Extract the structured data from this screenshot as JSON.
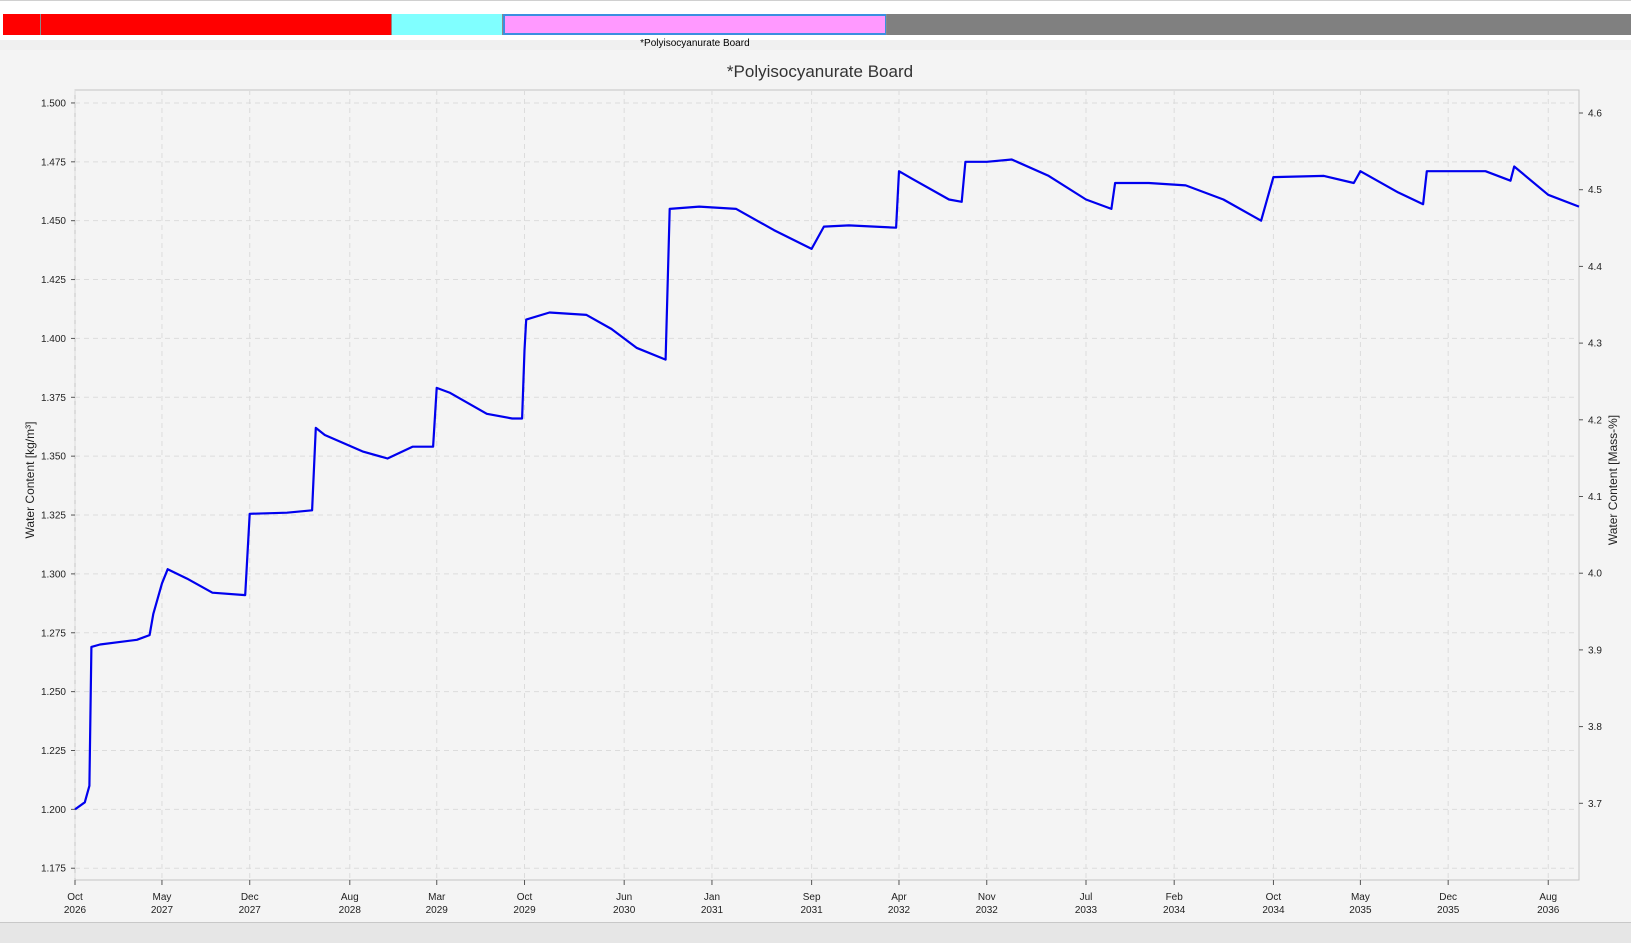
{
  "layer_bar": {
    "segments": [
      {
        "name": "layer-red",
        "color": "#ff0000",
        "start_fraction": 0.0,
        "end_fraction": 0.239,
        "selected": false
      },
      {
        "name": "layer-cyan",
        "color": "#80ffff",
        "start_fraction": 0.239,
        "end_fraction": 0.307,
        "selected": false
      },
      {
        "name": "layer-pink",
        "color": "#ff99ff",
        "start_fraction": 0.307,
        "end_fraction": 0.543,
        "selected": true
      },
      {
        "name": "layer-gray",
        "color": "#808080",
        "start_fraction": 0.543,
        "end_fraction": 1.0,
        "selected": false
      }
    ],
    "selected_label": "*Polyisocyanurate Board"
  },
  "chart_data": {
    "type": "line",
    "title": "*Polyisocyanurate Board",
    "ylabel_left": "Water Content [kg/m³]",
    "ylabel_right": "Water Content [Mass-%]",
    "xlabel": "",
    "grid": true,
    "line_color": "#0000ee",
    "ylim_left": [
      1.17,
      1.5055
    ],
    "ylim_right": [
      3.6,
      4.63
    ],
    "xlim": [
      "2026-10-01",
      "2036-10-15"
    ],
    "yticks_left": [
      "1.175",
      "1.200",
      "1.225",
      "1.250",
      "1.275",
      "1.300",
      "1.325",
      "1.350",
      "1.375",
      "1.400",
      "1.425",
      "1.450",
      "1.475",
      "1.500"
    ],
    "yticks_right": [
      "3.7",
      "3.8",
      "3.9",
      "4.0",
      "4.1",
      "4.2",
      "4.3",
      "4.4",
      "4.5",
      "4.6"
    ],
    "xticks": [
      {
        "date": "2026-10-01",
        "month": "Oct",
        "year": "2026"
      },
      {
        "date": "2027-05-01",
        "month": "May",
        "year": "2027"
      },
      {
        "date": "2027-12-01",
        "month": "Dec",
        "year": "2027"
      },
      {
        "date": "2028-08-01",
        "month": "Aug",
        "year": "2028"
      },
      {
        "date": "2029-03-01",
        "month": "Mar",
        "year": "2029"
      },
      {
        "date": "2029-10-01",
        "month": "Oct",
        "year": "2029"
      },
      {
        "date": "2030-06-01",
        "month": "Jun",
        "year": "2030"
      },
      {
        "date": "2031-01-01",
        "month": "Jan",
        "year": "2031"
      },
      {
        "date": "2031-09-01",
        "month": "Sep",
        "year": "2031"
      },
      {
        "date": "2032-04-01",
        "month": "Apr",
        "year": "2032"
      },
      {
        "date": "2032-11-01",
        "month": "Nov",
        "year": "2032"
      },
      {
        "date": "2033-07-01",
        "month": "Jul",
        "year": "2033"
      },
      {
        "date": "2034-02-01",
        "month": "Feb",
        "year": "2034"
      },
      {
        "date": "2034-10-01",
        "month": "Oct",
        "year": "2034"
      },
      {
        "date": "2035-05-01",
        "month": "May",
        "year": "2035"
      },
      {
        "date": "2035-12-01",
        "month": "Dec",
        "year": "2035"
      },
      {
        "date": "2036-08-01",
        "month": "Aug",
        "year": "2036"
      }
    ],
    "series": [
      {
        "values": [
          [
            "2026-10-01",
            1.2
          ],
          [
            "2026-10-25",
            1.203
          ],
          [
            "2026-11-05",
            1.21
          ],
          [
            "2026-11-10",
            1.269
          ],
          [
            "2026-12-01",
            1.27
          ],
          [
            "2027-03-01",
            1.272
          ],
          [
            "2027-04-01",
            1.274
          ],
          [
            "2027-04-10",
            1.283
          ],
          [
            "2027-05-01",
            1.296
          ],
          [
            "2027-05-15",
            1.302
          ],
          [
            "2027-07-01",
            1.298
          ],
          [
            "2027-09-01",
            1.292
          ],
          [
            "2027-11-20",
            1.291
          ],
          [
            "2027-12-01",
            1.3255
          ],
          [
            "2028-03-01",
            1.326
          ],
          [
            "2028-05-01",
            1.327
          ],
          [
            "2028-05-10",
            1.362
          ],
          [
            "2028-06-01",
            1.359
          ],
          [
            "2028-09-01",
            1.352
          ],
          [
            "2028-11-01",
            1.349
          ],
          [
            "2029-01-01",
            1.354
          ],
          [
            "2029-02-20",
            1.354
          ],
          [
            "2029-03-01",
            1.379
          ],
          [
            "2029-04-01",
            1.377
          ],
          [
            "2029-07-01",
            1.368
          ],
          [
            "2029-09-01",
            1.366
          ],
          [
            "2029-09-25",
            1.366
          ],
          [
            "2029-10-01",
            1.395
          ],
          [
            "2029-10-05",
            1.408
          ],
          [
            "2029-12-01",
            1.411
          ],
          [
            "2030-03-01",
            1.41
          ],
          [
            "2030-05-01",
            1.404
          ],
          [
            "2030-07-01",
            1.396
          ],
          [
            "2030-09-10",
            1.391
          ],
          [
            "2030-09-20",
            1.455
          ],
          [
            "2030-12-01",
            1.456
          ],
          [
            "2031-03-01",
            1.455
          ],
          [
            "2031-06-01",
            1.446
          ],
          [
            "2031-09-01",
            1.438
          ],
          [
            "2031-10-01",
            1.4475
          ],
          [
            "2031-12-01",
            1.448
          ],
          [
            "2032-03-25",
            1.447
          ],
          [
            "2032-04-01",
            1.471
          ],
          [
            "2032-05-01",
            1.468
          ],
          [
            "2032-08-01",
            1.459
          ],
          [
            "2032-09-01",
            1.458
          ],
          [
            "2032-09-10",
            1.475
          ],
          [
            "2032-11-01",
            1.475
          ],
          [
            "2033-01-01",
            1.476
          ],
          [
            "2033-04-01",
            1.469
          ],
          [
            "2033-07-01",
            1.459
          ],
          [
            "2033-09-01",
            1.455
          ],
          [
            "2033-09-10",
            1.466
          ],
          [
            "2033-12-01",
            1.466
          ],
          [
            "2034-03-01",
            1.465
          ],
          [
            "2034-06-01",
            1.459
          ],
          [
            "2034-09-01",
            1.45
          ],
          [
            "2034-10-01",
            1.4685
          ],
          [
            "2035-02-01",
            1.469
          ],
          [
            "2035-04-15",
            1.466
          ],
          [
            "2035-05-01",
            1.471
          ],
          [
            "2035-08-01",
            1.462
          ],
          [
            "2035-10-01",
            1.457
          ],
          [
            "2035-10-10",
            1.471
          ],
          [
            "2036-03-01",
            1.471
          ],
          [
            "2036-05-01",
            1.467
          ],
          [
            "2036-05-10",
            1.473
          ],
          [
            "2036-08-01",
            1.461
          ],
          [
            "2036-10-15",
            1.456
          ]
        ]
      }
    ]
  }
}
